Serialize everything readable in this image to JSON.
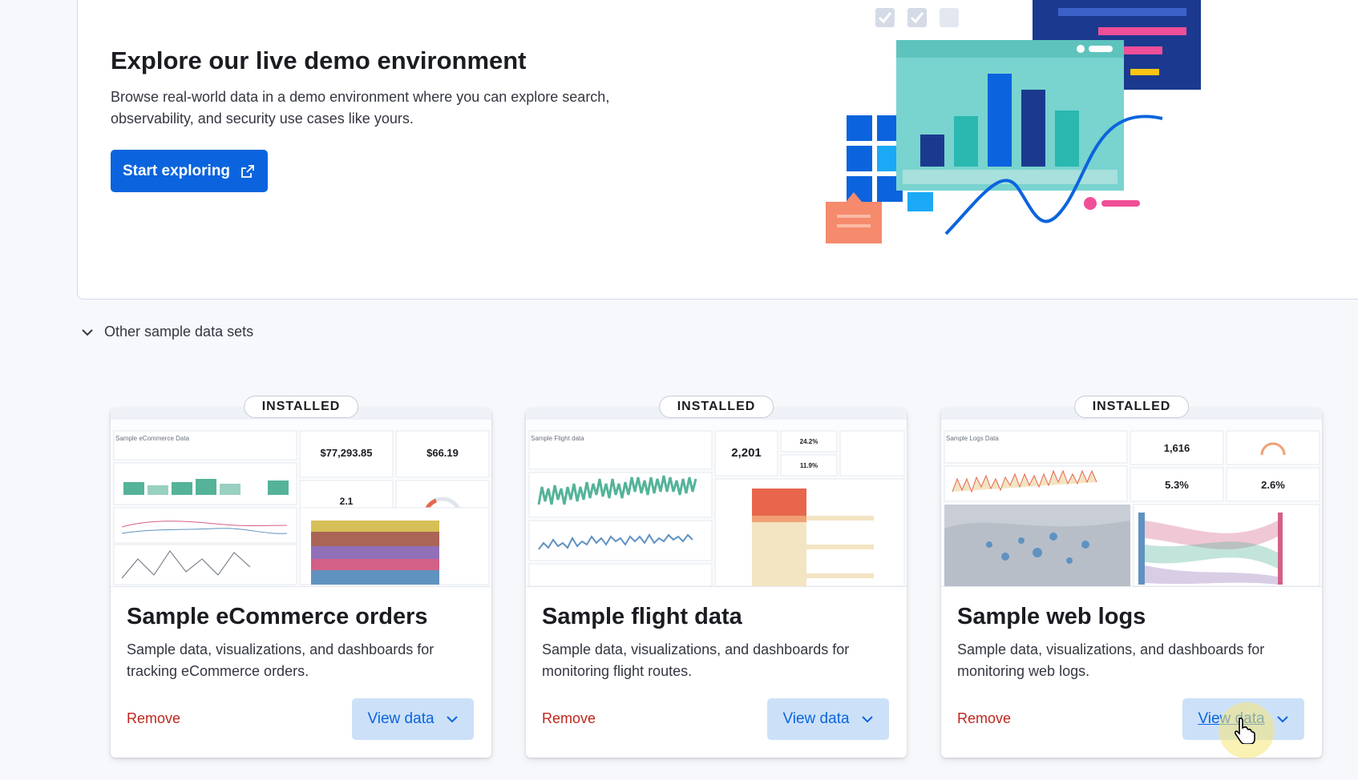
{
  "demo": {
    "title": "Explore our live demo environment",
    "description": "Browse real-world data in a demo environment where you can explore search, observability, and security use cases like yours.",
    "button_label": "Start exploring"
  },
  "other_sets": {
    "label": "Other sample data sets"
  },
  "cards": [
    {
      "badge": "INSTALLED",
      "title": "Sample eCommerce orders",
      "description": "Sample data, visualizations, and dashboards for tracking eCommerce orders.",
      "remove_label": "Remove",
      "view_label": "View data",
      "thumb": {
        "stat1": "$77,293.85",
        "stat2": "$66.19",
        "stat3": "2.1",
        "header": "Sample eCommerce Data"
      }
    },
    {
      "badge": "INSTALLED",
      "title": "Sample flight data",
      "description": "Sample data, visualizations, and dashboards for monitoring flight routes.",
      "remove_label": "Remove",
      "view_label": "View data",
      "thumb": {
        "stat1": "2,201",
        "stat2": "24.2%",
        "stat3": "11.9%",
        "header": "Sample Flight data"
      }
    },
    {
      "badge": "INSTALLED",
      "title": "Sample web logs",
      "description": "Sample data, visualizations, and dashboards for monitoring web logs.",
      "remove_label": "Remove",
      "view_label": "View data",
      "thumb": {
        "stat1": "1,616",
        "stat2": "5.3%",
        "stat3": "2.6%",
        "header": "Sample Logs Data"
      }
    }
  ]
}
